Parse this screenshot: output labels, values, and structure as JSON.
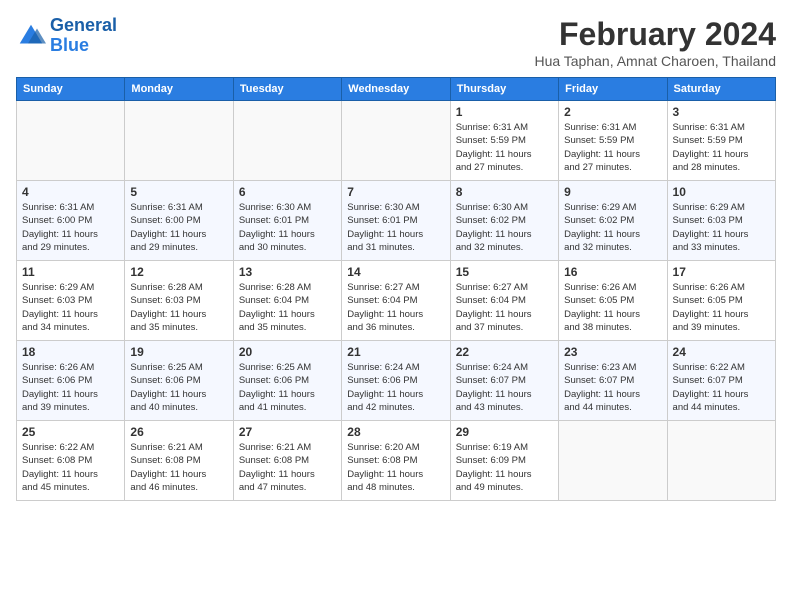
{
  "logo": {
    "line1": "General",
    "line2": "Blue"
  },
  "title": "February 2024",
  "subtitle": "Hua Taphan, Amnat Charoen, Thailand",
  "days_of_week": [
    "Sunday",
    "Monday",
    "Tuesday",
    "Wednesday",
    "Thursday",
    "Friday",
    "Saturday"
  ],
  "weeks": [
    [
      {
        "day": "",
        "info": ""
      },
      {
        "day": "",
        "info": ""
      },
      {
        "day": "",
        "info": ""
      },
      {
        "day": "",
        "info": ""
      },
      {
        "day": "1",
        "info": "Sunrise: 6:31 AM\nSunset: 5:59 PM\nDaylight: 11 hours\nand 27 minutes."
      },
      {
        "day": "2",
        "info": "Sunrise: 6:31 AM\nSunset: 5:59 PM\nDaylight: 11 hours\nand 27 minutes."
      },
      {
        "day": "3",
        "info": "Sunrise: 6:31 AM\nSunset: 5:59 PM\nDaylight: 11 hours\nand 28 minutes."
      }
    ],
    [
      {
        "day": "4",
        "info": "Sunrise: 6:31 AM\nSunset: 6:00 PM\nDaylight: 11 hours\nand 29 minutes."
      },
      {
        "day": "5",
        "info": "Sunrise: 6:31 AM\nSunset: 6:00 PM\nDaylight: 11 hours\nand 29 minutes."
      },
      {
        "day": "6",
        "info": "Sunrise: 6:30 AM\nSunset: 6:01 PM\nDaylight: 11 hours\nand 30 minutes."
      },
      {
        "day": "7",
        "info": "Sunrise: 6:30 AM\nSunset: 6:01 PM\nDaylight: 11 hours\nand 31 minutes."
      },
      {
        "day": "8",
        "info": "Sunrise: 6:30 AM\nSunset: 6:02 PM\nDaylight: 11 hours\nand 32 minutes."
      },
      {
        "day": "9",
        "info": "Sunrise: 6:29 AM\nSunset: 6:02 PM\nDaylight: 11 hours\nand 32 minutes."
      },
      {
        "day": "10",
        "info": "Sunrise: 6:29 AM\nSunset: 6:03 PM\nDaylight: 11 hours\nand 33 minutes."
      }
    ],
    [
      {
        "day": "11",
        "info": "Sunrise: 6:29 AM\nSunset: 6:03 PM\nDaylight: 11 hours\nand 34 minutes."
      },
      {
        "day": "12",
        "info": "Sunrise: 6:28 AM\nSunset: 6:03 PM\nDaylight: 11 hours\nand 35 minutes."
      },
      {
        "day": "13",
        "info": "Sunrise: 6:28 AM\nSunset: 6:04 PM\nDaylight: 11 hours\nand 35 minutes."
      },
      {
        "day": "14",
        "info": "Sunrise: 6:27 AM\nSunset: 6:04 PM\nDaylight: 11 hours\nand 36 minutes."
      },
      {
        "day": "15",
        "info": "Sunrise: 6:27 AM\nSunset: 6:04 PM\nDaylight: 11 hours\nand 37 minutes."
      },
      {
        "day": "16",
        "info": "Sunrise: 6:26 AM\nSunset: 6:05 PM\nDaylight: 11 hours\nand 38 minutes."
      },
      {
        "day": "17",
        "info": "Sunrise: 6:26 AM\nSunset: 6:05 PM\nDaylight: 11 hours\nand 39 minutes."
      }
    ],
    [
      {
        "day": "18",
        "info": "Sunrise: 6:26 AM\nSunset: 6:06 PM\nDaylight: 11 hours\nand 39 minutes."
      },
      {
        "day": "19",
        "info": "Sunrise: 6:25 AM\nSunset: 6:06 PM\nDaylight: 11 hours\nand 40 minutes."
      },
      {
        "day": "20",
        "info": "Sunrise: 6:25 AM\nSunset: 6:06 PM\nDaylight: 11 hours\nand 41 minutes."
      },
      {
        "day": "21",
        "info": "Sunrise: 6:24 AM\nSunset: 6:06 PM\nDaylight: 11 hours\nand 42 minutes."
      },
      {
        "day": "22",
        "info": "Sunrise: 6:24 AM\nSunset: 6:07 PM\nDaylight: 11 hours\nand 43 minutes."
      },
      {
        "day": "23",
        "info": "Sunrise: 6:23 AM\nSunset: 6:07 PM\nDaylight: 11 hours\nand 44 minutes."
      },
      {
        "day": "24",
        "info": "Sunrise: 6:22 AM\nSunset: 6:07 PM\nDaylight: 11 hours\nand 44 minutes."
      }
    ],
    [
      {
        "day": "25",
        "info": "Sunrise: 6:22 AM\nSunset: 6:08 PM\nDaylight: 11 hours\nand 45 minutes."
      },
      {
        "day": "26",
        "info": "Sunrise: 6:21 AM\nSunset: 6:08 PM\nDaylight: 11 hours\nand 46 minutes."
      },
      {
        "day": "27",
        "info": "Sunrise: 6:21 AM\nSunset: 6:08 PM\nDaylight: 11 hours\nand 47 minutes."
      },
      {
        "day": "28",
        "info": "Sunrise: 6:20 AM\nSunset: 6:08 PM\nDaylight: 11 hours\nand 48 minutes."
      },
      {
        "day": "29",
        "info": "Sunrise: 6:19 AM\nSunset: 6:09 PM\nDaylight: 11 hours\nand 49 minutes."
      },
      {
        "day": "",
        "info": ""
      },
      {
        "day": "",
        "info": ""
      }
    ]
  ]
}
